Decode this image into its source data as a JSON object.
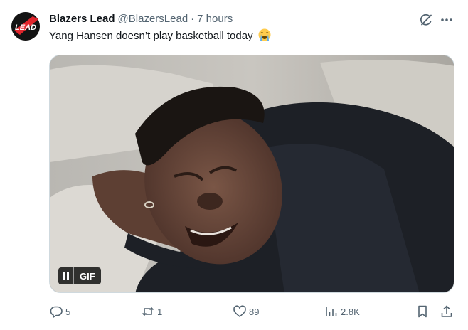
{
  "author": {
    "name": "Blazers Lead",
    "handle": "@BlazersLead",
    "separator": "·",
    "timestamp": "7 hours",
    "avatar_text": "LEAD"
  },
  "post": {
    "text": "Yang Hansen doesn’t play basketball today",
    "emoji": "loudly-crying-face"
  },
  "media": {
    "type": "gif",
    "badge_label": "GIF",
    "description_icon": "pause-icon"
  },
  "actions": {
    "replies": "5",
    "reposts": "1",
    "likes": "89",
    "views": "2.8K"
  },
  "colors": {
    "text_primary": "#0f1419",
    "text_secondary": "#536471",
    "border": "#cfd9de",
    "avatar_red": "#e0262d"
  }
}
